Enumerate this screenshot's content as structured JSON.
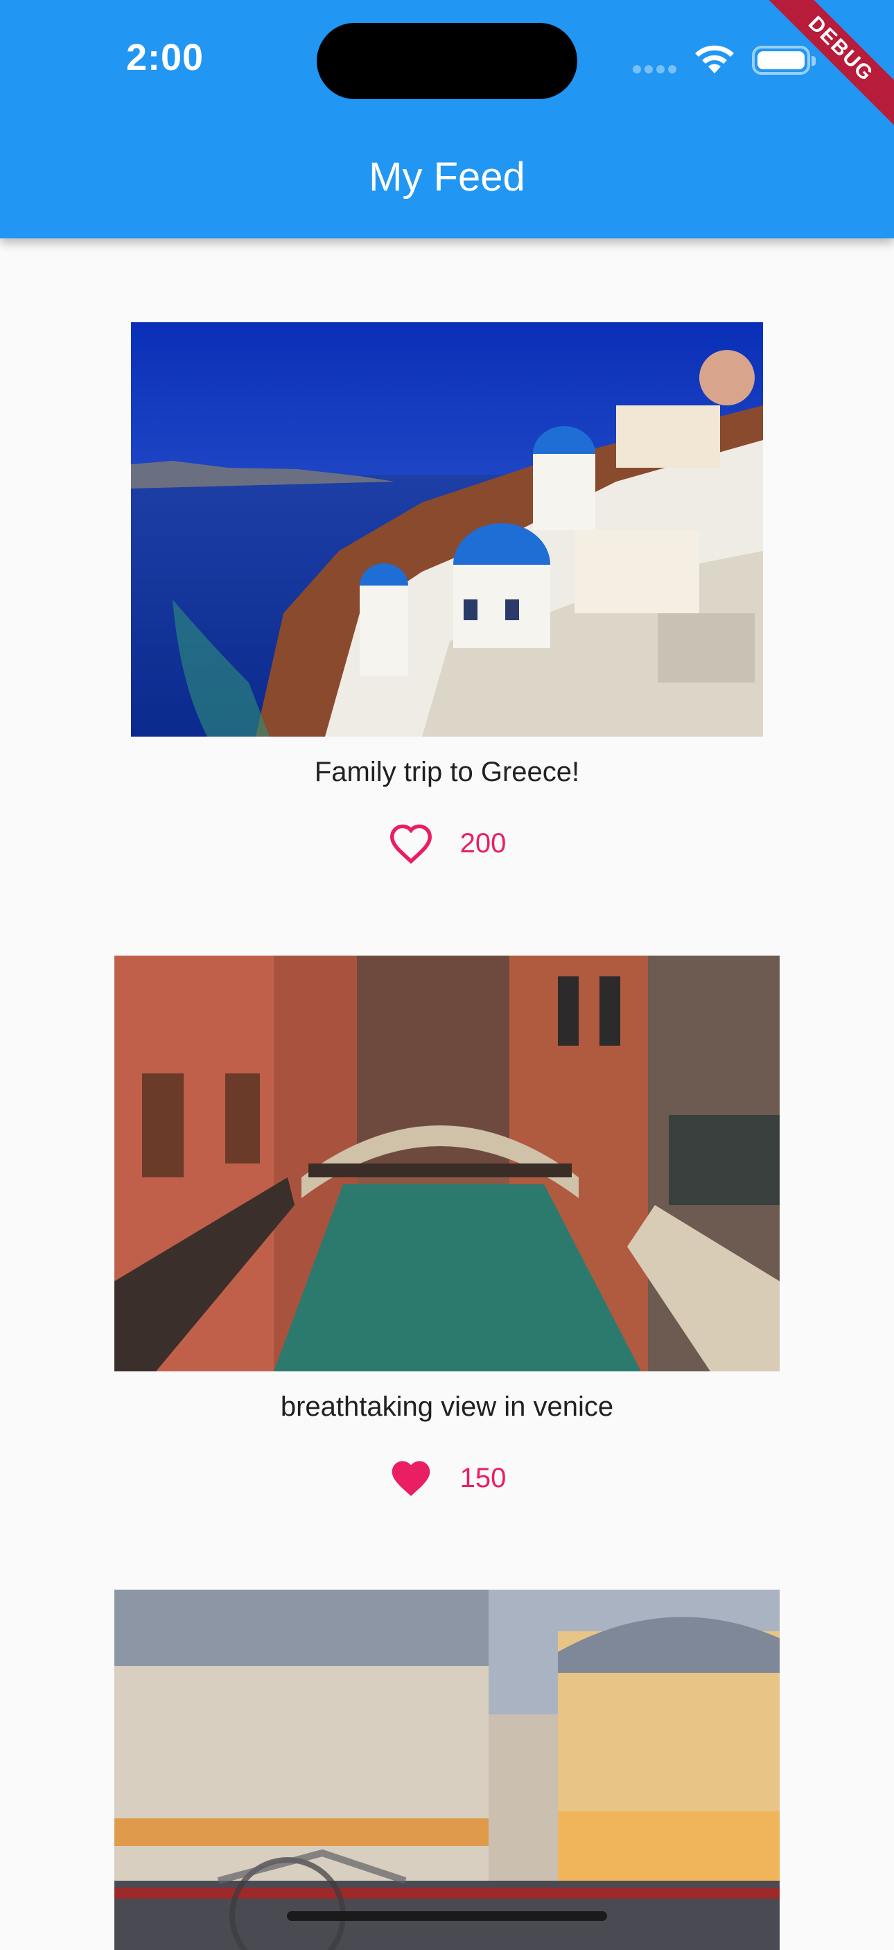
{
  "status_bar": {
    "time": "2:00"
  },
  "app_bar": {
    "title": "My Feed",
    "debug_label": "DEBUG",
    "color": "#2196f3"
  },
  "posts": [
    {
      "caption": "Family trip to Greece!",
      "likes": "200",
      "liked": false,
      "image": "santorini-photo"
    },
    {
      "caption": "breathtaking view in venice",
      "likes": "150",
      "liked": true,
      "image": "venice-canal-photo"
    },
    {
      "caption": "",
      "likes": "",
      "liked": false,
      "image": "paris-street-photo"
    }
  ],
  "colors": {
    "like": "#e91e63",
    "background": "#fafafa"
  }
}
